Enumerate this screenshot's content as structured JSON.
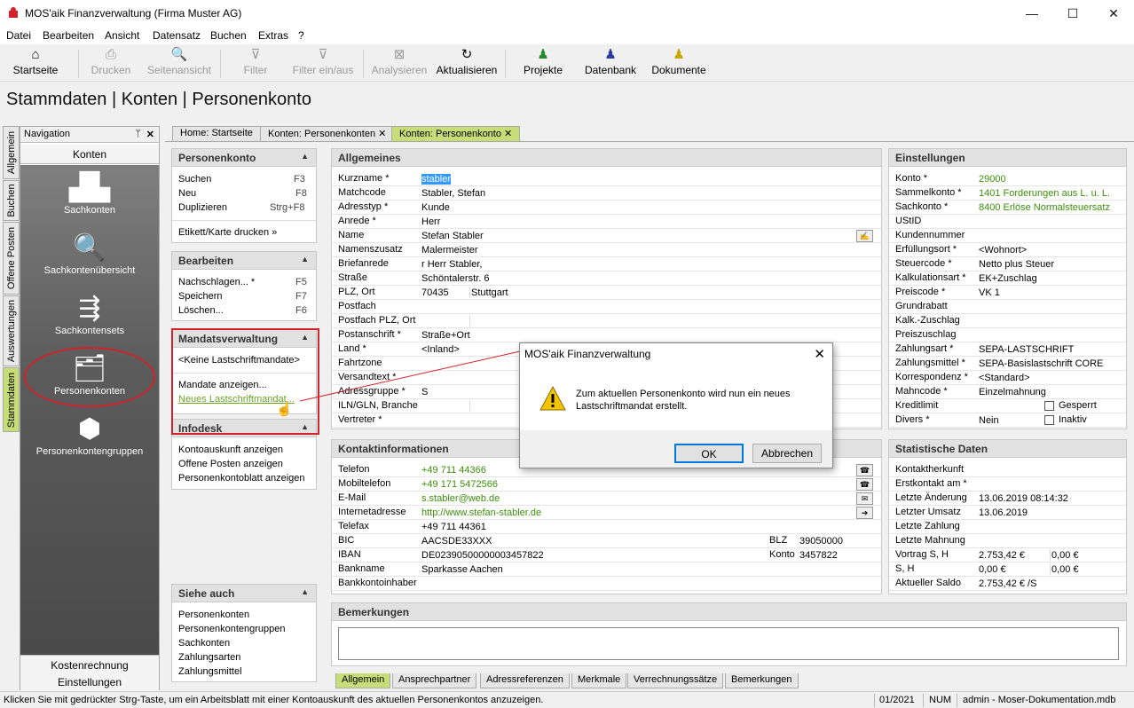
{
  "app": {
    "title": "MOS'aik Finanzverwaltung (Firma Muster AG)",
    "minimize": "—",
    "maximize": "☐",
    "close": "✕"
  },
  "menu": [
    "Datei",
    "Bearbeiten",
    "Ansicht",
    "Datensatz",
    "Buchen",
    "Extras",
    "?"
  ],
  "toolbar": [
    {
      "label": "Startseite",
      "icon": "home-icon",
      "glyph": "⌂",
      "enabled": true
    },
    {
      "label": "Drucken",
      "icon": "printer-icon",
      "glyph": "⎙",
      "enabled": false
    },
    {
      "label": "Seitenansicht",
      "icon": "page-preview-icon",
      "glyph": "🔍",
      "enabled": false
    },
    {
      "label": "Filter",
      "icon": "filter-icon",
      "glyph": "⊽",
      "enabled": false
    },
    {
      "label": "Filter ein/aus",
      "icon": "filter-toggle-icon",
      "glyph": "⊽",
      "enabled": false
    },
    {
      "label": "Analysieren",
      "icon": "analyze-icon",
      "glyph": "⊠",
      "enabled": false
    },
    {
      "label": "Aktualisieren",
      "icon": "refresh-icon",
      "glyph": "↻",
      "enabled": true
    },
    {
      "label": "Projekte",
      "icon": "projects-icon",
      "glyph": "♟",
      "enabled": true
    },
    {
      "label": "Datenbank",
      "icon": "database-icon",
      "glyph": "♟",
      "enabled": true
    },
    {
      "label": "Dokumente",
      "icon": "documents-icon",
      "glyph": "♟",
      "enabled": true
    }
  ],
  "page_title": "Stammdaten | Konten | Personenkonto",
  "vtabs": [
    "Allgemein",
    "Buchen",
    "Offene Posten",
    "Auswertungen",
    "Stammdaten"
  ],
  "nav": {
    "header": "Navigation",
    "pin": "ᛘ",
    "close": "✕",
    "top_button": "Konten",
    "items": [
      {
        "label": "Sachkonten",
        "glyph": "▟▙"
      },
      {
        "label": "Sachkontenübersicht",
        "glyph": "🔍"
      },
      {
        "label": "Sachkontensets",
        "glyph": "⇶"
      },
      {
        "label": "Personenkonten",
        "glyph": "🗂"
      },
      {
        "label": "Personenkontengruppen",
        "glyph": "⬢"
      }
    ],
    "bottom_buttons": [
      "Kostenrechnung",
      "Einstellungen"
    ]
  },
  "doc_tabs": [
    {
      "label": "Home: Startseite",
      "closable": false
    },
    {
      "label": "Konten: Personenkonten",
      "closable": true
    },
    {
      "label": "Konten: Personenkonto",
      "closable": true
    }
  ],
  "side_panels": {
    "personenkonto": {
      "title": "Personenkonto",
      "items": [
        {
          "label": "Suchen",
          "key": "F3"
        },
        {
          "label": "Neu",
          "key": "F8"
        },
        {
          "label": "Duplizieren",
          "key": "Strg+F8"
        }
      ],
      "extra": "Etikett/Karte drucken »"
    },
    "bearbeiten": {
      "title": "Bearbeiten",
      "items": [
        {
          "label": "Nachschlagen... *",
          "key": "F5"
        },
        {
          "label": "Speichern",
          "key": "F7"
        },
        {
          "label": "Löschen...",
          "key": "F6"
        }
      ]
    },
    "mandat": {
      "title": "Mandatsverwaltung",
      "none": "<Keine Lastschriftmandate>",
      "show": "Mandate anzeigen...",
      "new": "Neues Lastschriftmandat..."
    },
    "infodesk": {
      "title": "Infodesk",
      "items": [
        "Kontoauskunft anzeigen",
        "Offene Posten anzeigen",
        "Personenkontoblatt anzeigen"
      ]
    },
    "siehe": {
      "title": "Siehe auch",
      "items": [
        "Personenkonten",
        "Personenkontengruppen",
        "Sachkonten",
        "Zahlungsarten",
        "Zahlungsmittel"
      ]
    }
  },
  "allgemeines": {
    "title": "Allgemeines",
    "rows": [
      {
        "label": "Kurzname *",
        "value": "stabler",
        "selected": true
      },
      {
        "label": "Matchcode",
        "value": "Stabler, Stefan"
      },
      {
        "label": "Adresstyp *",
        "value": "Kunde"
      },
      {
        "label": "Anrede *",
        "value": "Herr"
      },
      {
        "label": "Name",
        "value": "Stefan Stabler",
        "button": "✍"
      },
      {
        "label": "Namenszusatz",
        "value": "Malermeister"
      },
      {
        "label": "Briefanrede",
        "value": "r Herr Stabler,"
      },
      {
        "label": "Straße",
        "value": "Schöntalerstr. 6"
      },
      {
        "label": "PLZ, Ort",
        "value": "70435",
        "value2": "Stuttgart"
      },
      {
        "label": "Postfach",
        "value": ""
      },
      {
        "label": "Postfach PLZ, Ort",
        "value": "",
        "value2": ""
      },
      {
        "label": "Postanschrift *",
        "value": "Straße+Ort"
      },
      {
        "label": "Land *",
        "value": "<Inland>"
      },
      {
        "label": "Fahrtzone",
        "value": ""
      },
      {
        "label": "Versandtext *",
        "value": ""
      },
      {
        "label": "Adressgruppe *",
        "value": "S"
      },
      {
        "label": "ILN/GLN, Branche",
        "value": "",
        "value2": ""
      },
      {
        "label": "Vertreter *",
        "value": ""
      }
    ]
  },
  "einstellungen": {
    "title": "Einstellungen",
    "rows": [
      {
        "label": "Konto *",
        "value": "29000",
        "green": true
      },
      {
        "label": "Sammelkonto *",
        "value": "1401 Forderungen aus L. u. L.",
        "green": true
      },
      {
        "label": "Sachkonto *",
        "value": "8400 Erlöse Normalsteuersatz",
        "green": true
      },
      {
        "label": "UStID",
        "value": ""
      },
      {
        "label": "Kundennummer",
        "value": ""
      },
      {
        "label": "Erfüllungsort *",
        "value": "<Wohnort>"
      },
      {
        "label": "Steuercode *",
        "value": "Netto plus Steuer"
      },
      {
        "label": "Kalkulationsart *",
        "value": "EK+Zuschlag"
      },
      {
        "label": "Preiscode *",
        "value": "VK 1"
      },
      {
        "label": "Grundrabatt",
        "value": ""
      },
      {
        "label": "Kalk.-Zuschlag",
        "value": ""
      },
      {
        "label": "Preiszuschlag",
        "value": ""
      },
      {
        "label": "Zahlungsart *",
        "value": "SEPA-LASTSCHRIFT"
      },
      {
        "label": "Zahlungsmittel *",
        "value": "SEPA-Basislastschrift CORE"
      },
      {
        "label": "Korrespondenz *",
        "value": "<Standard>"
      },
      {
        "label": "Mahncode *",
        "value": "Einzelmahnung"
      },
      {
        "label": "Kreditlimit",
        "value": "",
        "check": "Gesperrt"
      },
      {
        "label": "Divers *",
        "value": "Nein",
        "check": "Inaktiv"
      }
    ]
  },
  "kontakt": {
    "title": "Kontaktinformationen",
    "rows": [
      {
        "label": "Telefon",
        "value": "+49 711 44366",
        "green": true,
        "button": "☎"
      },
      {
        "label": "Mobiltelefon",
        "value": "+49 171 5472566",
        "green": true,
        "button": "☎"
      },
      {
        "label": "E-Mail",
        "value": "s.stabler@web.de",
        "green": true,
        "button": "✉"
      },
      {
        "label": "Internetadresse",
        "value": "http://www.stefan-stabler.de",
        "green": true,
        "button": "➔"
      },
      {
        "label": "Telefax",
        "value": "+49 711 44361"
      },
      {
        "label": "BIC",
        "value": "AACSDE33XXX",
        "label2": "BLZ",
        "value2": "39050000"
      },
      {
        "label": "IBAN",
        "value": "DE02390500000003457822",
        "label2": "Konto",
        "value2": "3457822"
      },
      {
        "label": "Bankname",
        "value": "Sparkasse Aachen"
      },
      {
        "label": "Bankkontoinhaber",
        "value": ""
      }
    ]
  },
  "statistik": {
    "title": "Statistische Daten",
    "rows": [
      {
        "label": "Kontaktherkunft",
        "value": ""
      },
      {
        "label": "Erstkontakt am *",
        "value": ""
      },
      {
        "label": "Letzte Änderung",
        "value": "13.06.2019 08:14:32"
      },
      {
        "label": "Letzter Umsatz",
        "value": "13.06.2019"
      },
      {
        "label": "Letzte Zahlung",
        "value": ""
      },
      {
        "label": "Letzte Mahnung",
        "value": ""
      },
      {
        "label": "Vortrag S, H",
        "value": "2.753,42 €",
        "value2": "0,00 €"
      },
      {
        "label": "S, H",
        "value": "0,00 €",
        "value2": "0,00 €"
      },
      {
        "label": "Aktueller Saldo",
        "value": "2.753,42 € /S"
      }
    ]
  },
  "bemerkungen": {
    "title": "Bemerkungen"
  },
  "bottom_tabs": [
    "Allgemein",
    "Ansprechpartner",
    "Adressreferenzen",
    "Merkmale",
    "Verrechnungssätze",
    "Bemerkungen"
  ],
  "status": {
    "hint": "Klicken Sie mit gedrückter Strg-Taste, um ein Arbeitsblatt mit einer Kontoauskunft des aktuellen Personenkontos anzuzeigen.",
    "period": "01/2021",
    "num": "NUM",
    "db": "admin - Moser-Dokumentation.mdb"
  },
  "dialog": {
    "title": "MOS'aik Finanzverwaltung",
    "message": "Zum aktuellen Personenkonto wird nun ein neues Lastschriftmandat erstellt.",
    "ok": "OK",
    "cancel": "Abbrechen",
    "icon": "warning-icon"
  },
  "colors": {
    "accent_green": "#c7dd78",
    "highlight_red": "#d2232a",
    "link_green": "#3c8f0a"
  }
}
